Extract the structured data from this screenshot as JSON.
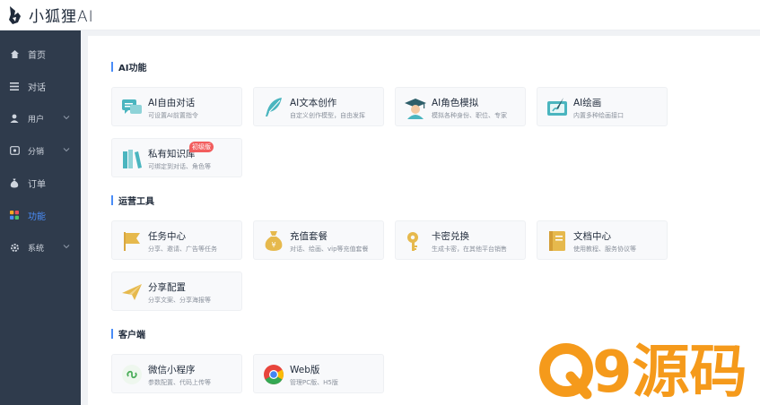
{
  "header": {
    "logo_text": "小狐狸AI"
  },
  "sidebar": {
    "items": [
      {
        "label": "首页",
        "icon": "home-icon"
      },
      {
        "label": "对话",
        "icon": "menu-lines-icon"
      },
      {
        "label": "用户",
        "icon": "user-icon",
        "expandable": true
      },
      {
        "label": "分销",
        "icon": "share-box-icon",
        "expandable": true
      },
      {
        "label": "订单",
        "icon": "money-bag-icon"
      },
      {
        "label": "功能",
        "icon": "grid-apps-icon",
        "active": true
      },
      {
        "label": "系统",
        "icon": "gear-icon",
        "expandable": true
      }
    ]
  },
  "sections": [
    {
      "title": "AI功能",
      "cards": [
        {
          "title": "AI自由对话",
          "desc": "可设置AI前置指令",
          "icon": "chat-bubbles-icon"
        },
        {
          "title": "AI文本创作",
          "desc": "自定义创作模型，自由发挥",
          "icon": "feather-pen-icon"
        },
        {
          "title": "AI角色模拟",
          "desc": "模拟各种身份、职位、专家",
          "icon": "graduate-cap-icon"
        },
        {
          "title": "AI绘画",
          "desc": "内置多种绘画接口",
          "icon": "paint-brush-icon"
        },
        {
          "title": "私有知识库",
          "desc": "可绑定到对话、角色等",
          "icon": "books-icon",
          "badge": "初级版"
        }
      ]
    },
    {
      "title": "运营工具",
      "cards": [
        {
          "title": "任务中心",
          "desc": "分享、邀请、广告等任务",
          "icon": "flag-icon"
        },
        {
          "title": "充值套餐",
          "desc": "对话、绘画、vip等充值套餐",
          "icon": "money-bag-icon"
        },
        {
          "title": "卡密兑换",
          "desc": "生成卡密，在其他平台销售",
          "icon": "key-icon"
        },
        {
          "title": "文档中心",
          "desc": "使用教程、服务协议等",
          "icon": "document-icon"
        },
        {
          "title": "分享配置",
          "desc": "分享文案、分享海报等",
          "icon": "paper-plane-icon"
        }
      ]
    },
    {
      "title": "客户端",
      "cards": [
        {
          "title": "微信小程序",
          "desc": "参数配置、代码上传等",
          "icon": "mini-program-icon"
        },
        {
          "title": "Web版",
          "desc": "管理PC版、H5版",
          "icon": "chrome-icon"
        }
      ]
    }
  ],
  "watermark": {
    "text": "Q9源码"
  },
  "colors": {
    "sidebar_bg": "#2f3b4c",
    "accent": "#4a8cf7",
    "icon_teal": "#4ab5bf",
    "icon_gold": "#e6b94d",
    "badge_red": "#f25d5d",
    "watermark_orange": "#f59a1b"
  }
}
